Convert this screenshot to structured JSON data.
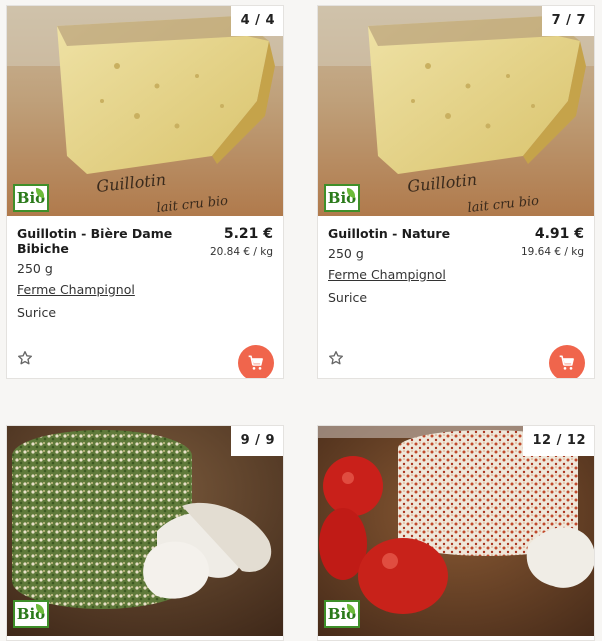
{
  "products": [
    {
      "counter": "4 / 4",
      "bio_label": "Bio",
      "name": "Guillotin - Bière Dame Bibiche",
      "price": "5.21 €",
      "unit_price": "20.84 € / kg",
      "weight": "250 g",
      "farm": "Ferme Champignol",
      "town": "Surice",
      "photo_text_1": "Guillotin",
      "photo_text_2": "lait cru bio"
    },
    {
      "counter": "7 / 7",
      "bio_label": "Bio",
      "name": "Guillotin - Nature",
      "price": "4.91 €",
      "unit_price": "19.64 € / kg",
      "weight": "250 g",
      "farm": "Ferme Champignol",
      "town": "Surice",
      "photo_text_1": "Guillotin",
      "photo_text_2": "lait cru bio"
    },
    {
      "counter": "9 / 9",
      "bio_label": "Bio"
    },
    {
      "counter": "12 / 12",
      "bio_label": "Bio"
    }
  ],
  "icons": {
    "favorite": "star-outline-icon",
    "cart": "shopping-cart-icon",
    "organic": "bio-label-icon"
  },
  "colors": {
    "cart_button": "#f0654c",
    "bio_green": "#3f8f2a",
    "background": "#f7f6f4"
  }
}
